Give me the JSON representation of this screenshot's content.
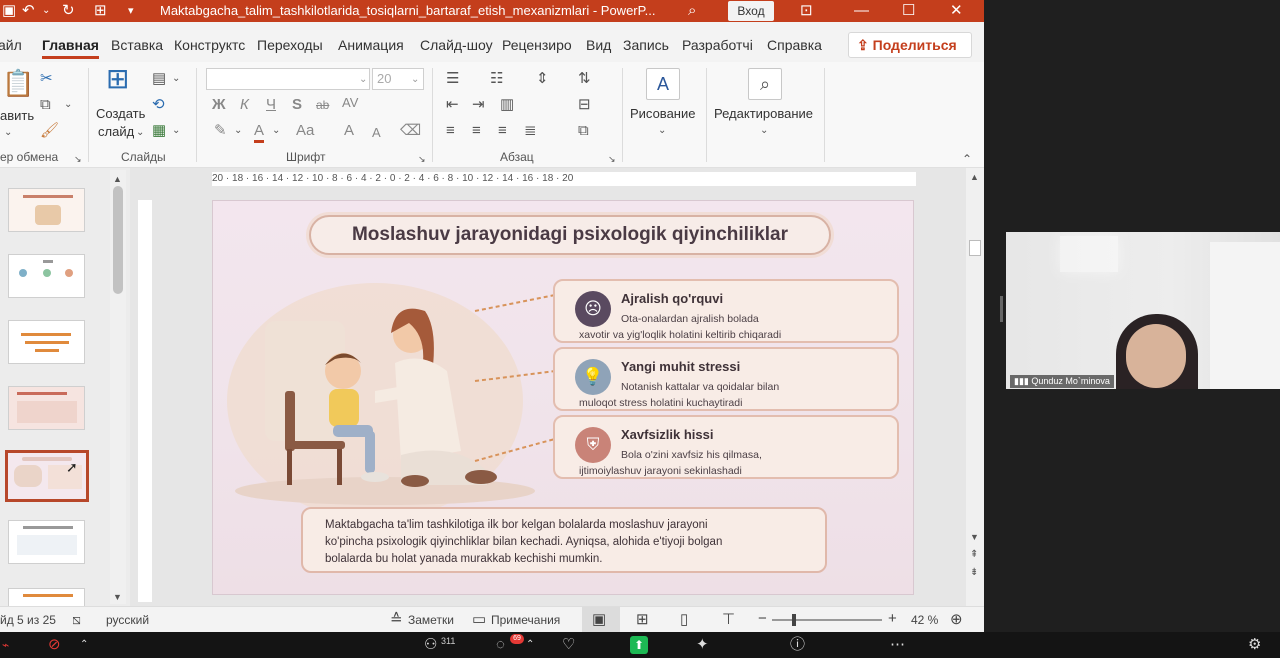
{
  "titlebar": {
    "filename": "Maktabgacha_talim_tashkilotlarida_tosiqlarni_bartaraf_etish_mexanizmlari  -  PowerP...",
    "signin": "Вход"
  },
  "tabs": [
    "айл",
    "Главная",
    "Вставка",
    "Конструктс",
    "Переходы",
    "Анимация",
    "Слайд-шоу",
    "Рецензиро",
    "Вид",
    "Запись",
    "Разработчі",
    "Справка"
  ],
  "share_label": "Поделиться",
  "ribbon": {
    "clipboard_partial": "авить",
    "clipboard_label": "ер обмена",
    "new_slide_line1": "Создать",
    "new_slide_line2": "слайд",
    "slides_label": "Слайды",
    "font_size": "20",
    "font_label": "Шрифт",
    "paragraph_label": "Абзац",
    "drawing_label": "Рисование",
    "editing_label": "Редактирование",
    "bold": "Ж",
    "italic": "К",
    "underline": "Ч",
    "shadow": "S",
    "strike": "ab",
    "spacing": "AV",
    "font_color": "A",
    "change_case": "Aa",
    "grow": "A",
    "shrink": "A"
  },
  "ruler_text": "20 · 18 · 16 · 14 · 12 · 10 · 8 · 6 · 4 · 2 · 0 · 2 · 4 · 6 · 8 · 10 · 12 · 14 · 16 · 18 · 20",
  "slide": {
    "title": "Moslashuv jarayonidagi psixologik qiyinchiliklar",
    "cards": [
      {
        "heading": "Ajralish qo'rquvi",
        "line1": "Ota-onalardan ajralish bolada",
        "line2": "xavotir va yig'loqlik holatini keltirib chiqaradi",
        "icon": "sad-face-icon",
        "color": "#5a4a60"
      },
      {
        "heading": "Yangi muhit stressi",
        "line1": "Notanish kattalar va qoidalar bilan",
        "line2": "muloqot stress holatini kuchaytiradi",
        "icon": "lightbulb-icon",
        "color": "#8fa3b8"
      },
      {
        "heading": "Xavfsizlik hissi",
        "line1": "Bola o'zini xavfsiz his qilmasa,",
        "line2": "ijtimoiylashuv jarayoni sekinlashadi",
        "icon": "shield-icon",
        "color": "#c98378"
      }
    ],
    "bottom_lines": [
      "Maktabgacha ta'lim tashkilotiga ilk bor kelgan bolalarda moslashuv jarayoni",
      "ko'pincha psixologik qiyinchliklar bilan kechadi. Ayniqsa, alohida e'tiyoji bolgan",
      "bolalarda bu holat yanada murakkab kechishi mumkin."
    ]
  },
  "status": {
    "slide_counter": "йд 5 из 25",
    "language": "русский",
    "notes": "Заметки",
    "comments": "Примечания",
    "zoom_minus": "−",
    "zoom_plus": "+",
    "zoom": "42 %"
  },
  "video": {
    "participant": "Qunduz Mo`minova"
  },
  "meeting": {
    "participants_count": "311",
    "chat_badge": "69"
  },
  "colors": {
    "accent": "#c43e1c",
    "selected_thumb": "#b7472a"
  }
}
